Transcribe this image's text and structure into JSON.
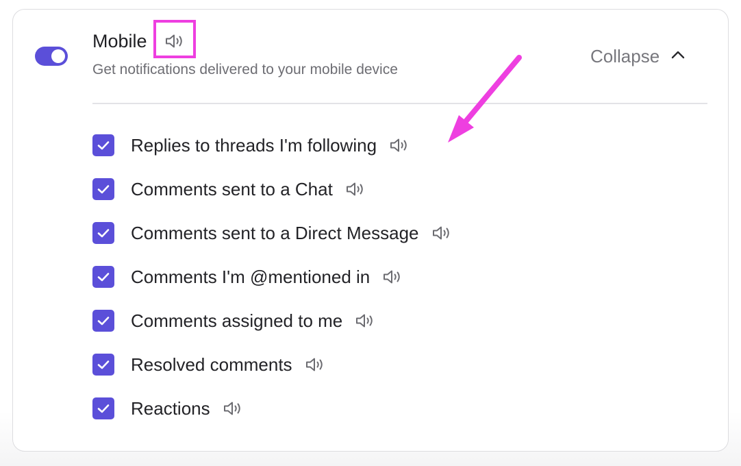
{
  "section": {
    "title": "Mobile",
    "subtitle": "Get notifications delivered to your mobile device",
    "toggle_enabled": true,
    "collapse_label": "Collapse"
  },
  "options": [
    {
      "label": "Replies to threads I'm following",
      "checked": true
    },
    {
      "label": "Comments sent to a Chat",
      "checked": true
    },
    {
      "label": "Comments sent to a Direct Message",
      "checked": true
    },
    {
      "label": "Comments I'm @mentioned in",
      "checked": true
    },
    {
      "label": "Comments assigned to me",
      "checked": true
    },
    {
      "label": "Resolved comments",
      "checked": true
    },
    {
      "label": "Reactions",
      "checked": true
    }
  ],
  "icons": {
    "speaker": "speaker-volume-icon",
    "checkmark": "checkmark-icon",
    "chevron": "chevron-up-icon"
  },
  "colors": {
    "accent": "#5b4fd9",
    "annotation": "#ee3fe0",
    "icon_gray": "#6b6b70"
  }
}
